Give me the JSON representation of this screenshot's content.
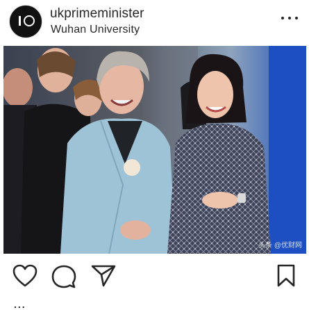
{
  "post": {
    "username": "ukprimeminister",
    "location": "Wuhan University"
  },
  "icons": {
    "avatar": "number-10-logo",
    "more": "ellipsis-horizontal-icon",
    "like": "heart-icon",
    "comment": "speech-bubble-icon",
    "share": "paper-plane-icon",
    "save": "bookmark-icon"
  },
  "photo": {
    "watermark": "头条 @优财网"
  },
  "likes": {
    "partial": "..."
  }
}
